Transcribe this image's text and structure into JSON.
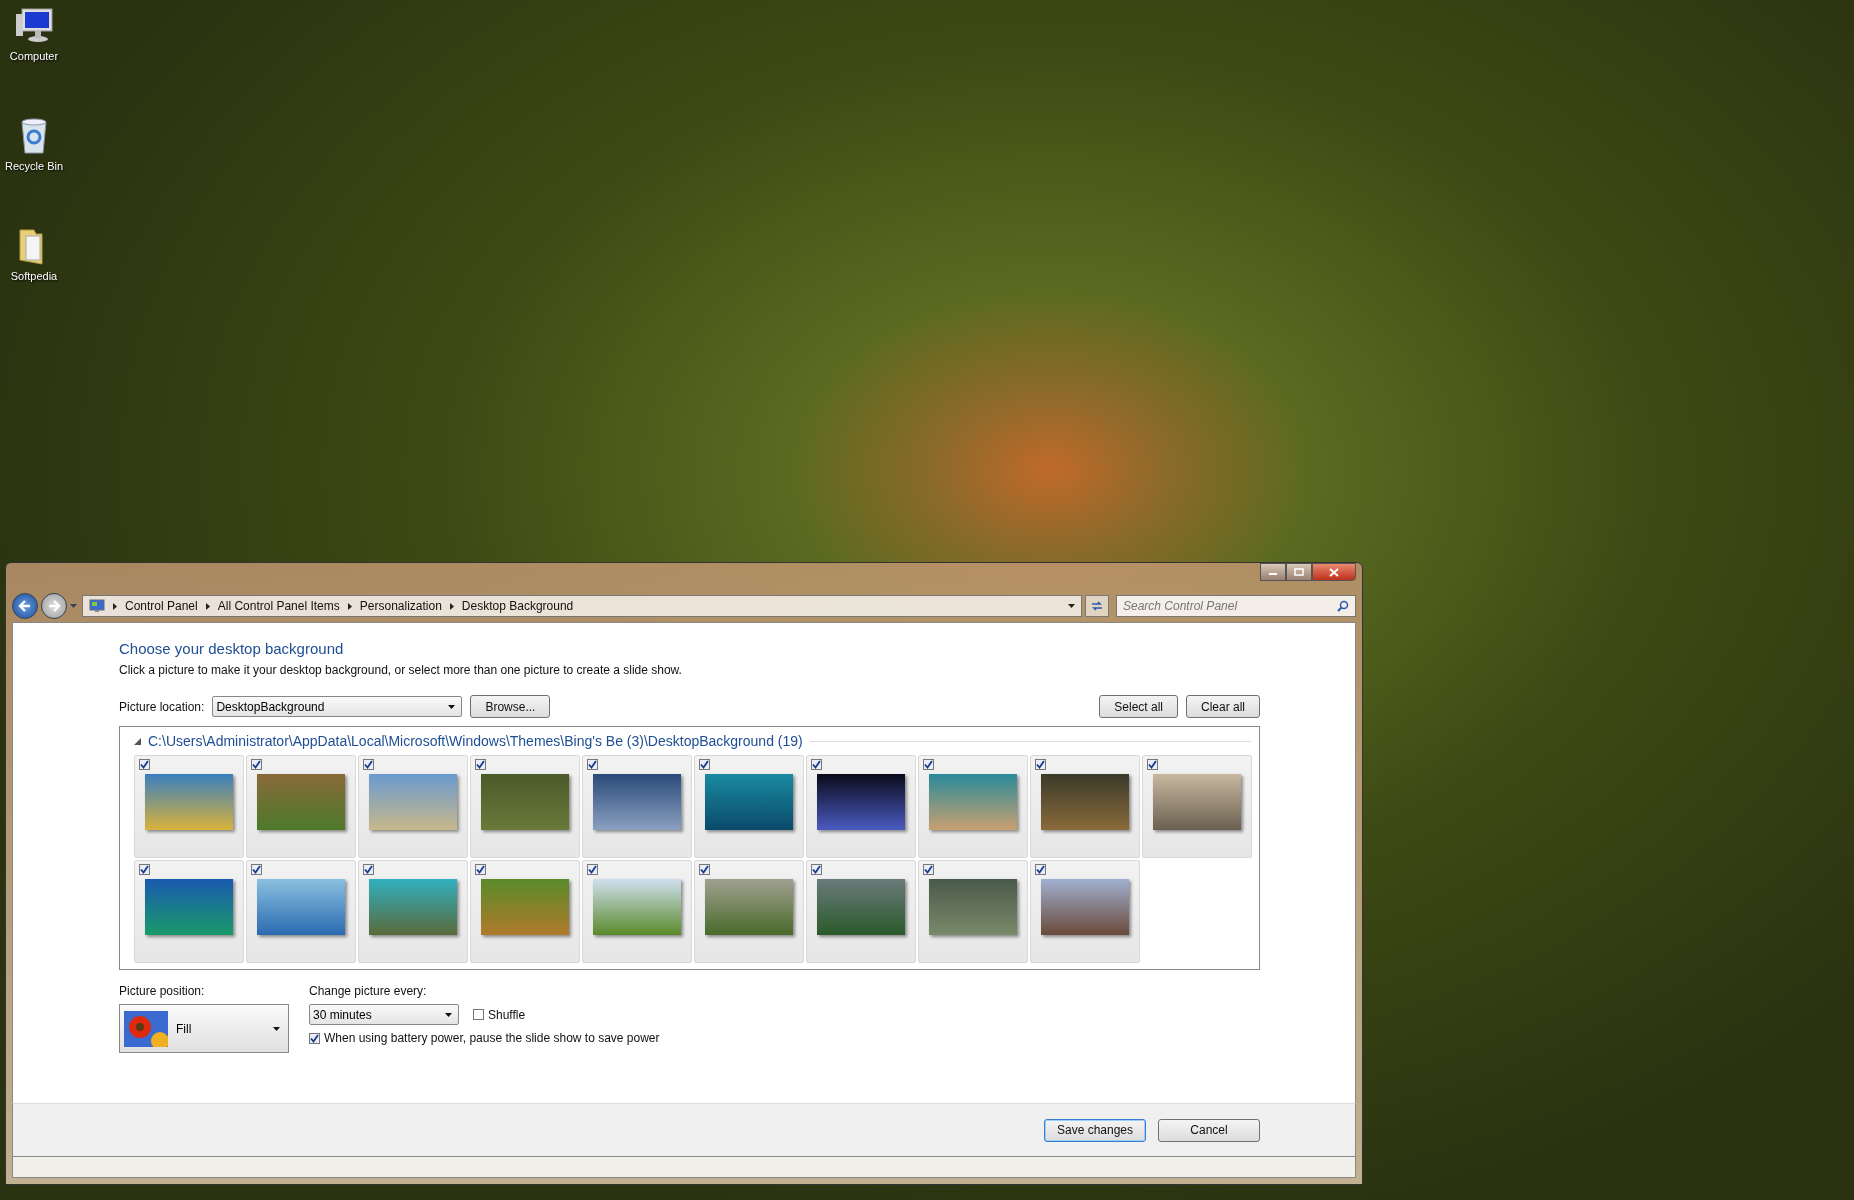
{
  "desktop_icons": [
    {
      "kind": "computer",
      "label": "Computer"
    },
    {
      "kind": "recycle",
      "label": "Recycle Bin"
    },
    {
      "kind": "folder",
      "label": "Softpedia"
    }
  ],
  "window": {
    "breadcrumb": [
      "Control Panel",
      "All Control Panel Items",
      "Personalization",
      "Desktop Background"
    ],
    "search": {
      "placeholder": "Search Control Panel"
    },
    "heading": "Choose your desktop background",
    "description": "Click a picture to make it your desktop background, or select more than one picture to create a slide show.",
    "picture_location": {
      "label": "Picture location:",
      "value": "DesktopBackground"
    },
    "browse_button": "Browse...",
    "select_all_button": "Select all",
    "clear_all_button": "Clear all",
    "group": {
      "path": "C:\\Users\\Administrator\\AppData\\Local\\Microsoft\\Windows\\Themes\\Bing's Be (3)\\DesktopBackground (19)",
      "expanded": true,
      "pictures": [
        {
          "checked": true
        },
        {
          "checked": true
        },
        {
          "checked": true
        },
        {
          "checked": true
        },
        {
          "checked": true
        },
        {
          "checked": true
        },
        {
          "checked": true
        },
        {
          "checked": true
        },
        {
          "checked": true
        },
        {
          "checked": true
        },
        {
          "checked": true
        },
        {
          "checked": true
        },
        {
          "checked": true
        },
        {
          "checked": true
        },
        {
          "checked": true
        },
        {
          "checked": true
        },
        {
          "checked": true
        },
        {
          "checked": true
        },
        {
          "checked": true
        }
      ]
    },
    "picture_position": {
      "label": "Picture position:",
      "value": "Fill"
    },
    "change_picture": {
      "label": "Change picture every:",
      "value": "30 minutes"
    },
    "shuffle": {
      "label": "Shuffle",
      "checked": false
    },
    "battery": {
      "label": "When using battery power, pause the slide show to save power",
      "checked": true
    },
    "buttons": [
      "Save changes",
      "Cancel"
    ]
  }
}
